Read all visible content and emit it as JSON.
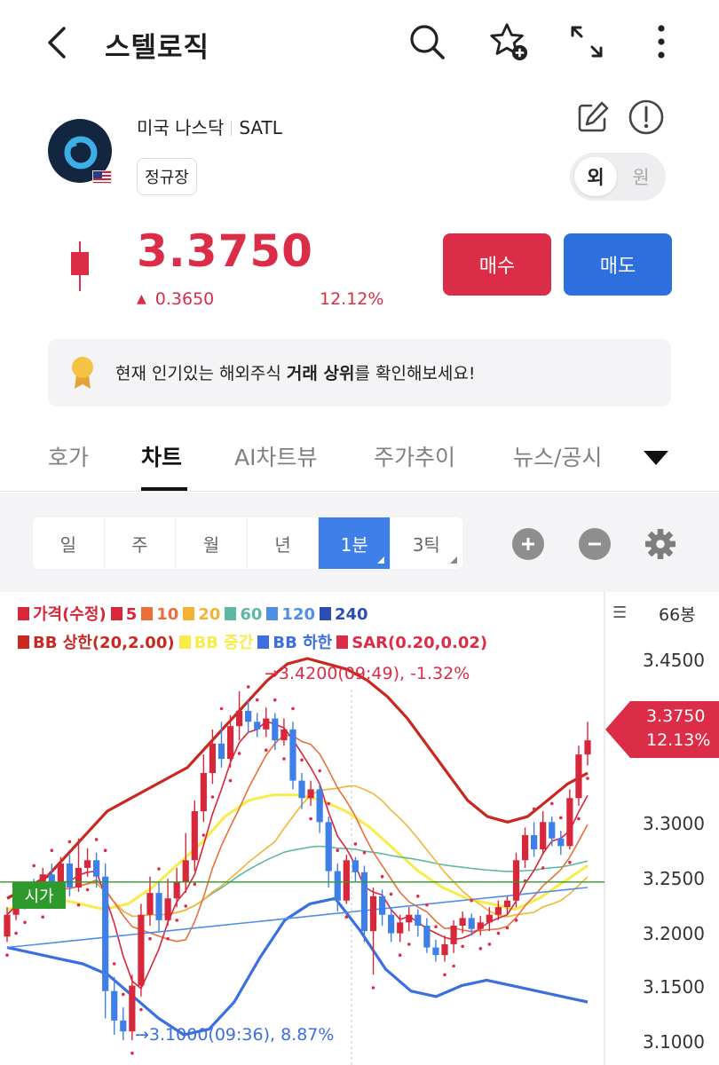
{
  "header": {
    "title": "스텔로직"
  },
  "stock": {
    "market": "미국 나스닥",
    "ticker": "SATL",
    "session": "정규장",
    "currency_on": "외",
    "currency_off": "원",
    "price": "3.3750",
    "change": "0.3650",
    "change_pct": "12.12%"
  },
  "actions": {
    "buy": "매수",
    "sell": "매도"
  },
  "banner": {
    "pre": "현재 인기있는 해외주식 ",
    "bold": "거래 상위",
    "post": "를 확인해보세요!"
  },
  "tabs": [
    "호가",
    "차트",
    "AI차트뷰",
    "주가추이",
    "뉴스/공시"
  ],
  "periods": [
    "일",
    "주",
    "월",
    "년",
    "1분",
    "3틱"
  ],
  "legend": {
    "row1": [
      {
        "label": "가격(수정)",
        "color": "#d8263b"
      },
      {
        "label": "5",
        "color": "#d8263b"
      },
      {
        "label": "10",
        "color": "#e8703a"
      },
      {
        "label": "20",
        "color": "#f3b436"
      },
      {
        "label": "60",
        "color": "#5fb8a4"
      },
      {
        "label": "120",
        "color": "#4f8fe4"
      },
      {
        "label": "240",
        "color": "#2a4fb0"
      }
    ],
    "row2": [
      {
        "label": "BB 상한(20,2.00)",
        "color": "#c8281f"
      },
      {
        "label": "BB 중간",
        "color": "#f8ec4a"
      },
      {
        "label": "BB 하한",
        "color": "#3b6fe0"
      },
      {
        "label": "SAR(0.20,0.02)",
        "color": "#dc2d48"
      }
    ]
  },
  "axis": {
    "count": "66봉",
    "ticks": [
      "3.4500",
      "3.3000",
      "3.2500",
      "3.2000",
      "3.1500",
      "3.1000"
    ]
  },
  "chart_data": {
    "type": "candlestick",
    "interval": "1분",
    "y_range": [
      3.09,
      3.47
    ],
    "current": {
      "price": "3.3750",
      "pct": "12.13%"
    },
    "open_label": "시가",
    "open_price": 3.245,
    "high_annotation": "3.4200(09:49), -1.32%",
    "low_annotation": "3.1000(09:36), 8.87%",
    "candles": [
      [
        3.195,
        3.215,
        3.19,
        3.222
      ],
      [
        3.215,
        3.232,
        3.21,
        3.24
      ],
      [
        3.232,
        3.238,
        3.22,
        3.245
      ],
      [
        3.238,
        3.228,
        3.222,
        3.248
      ],
      [
        3.228,
        3.252,
        3.225,
        3.258
      ],
      [
        3.252,
        3.245,
        3.238,
        3.262
      ],
      [
        3.245,
        3.262,
        3.24,
        3.268
      ],
      [
        3.262,
        3.24,
        3.232,
        3.27
      ],
      [
        3.24,
        3.258,
        3.236,
        3.285
      ],
      [
        3.258,
        3.265,
        3.25,
        3.276
      ],
      [
        3.265,
        3.25,
        3.24,
        3.272
      ],
      [
        3.25,
        3.145,
        3.12,
        3.262
      ],
      [
        3.145,
        3.118,
        3.105,
        3.158
      ],
      [
        3.118,
        3.108,
        3.1,
        3.13
      ],
      [
        3.108,
        3.15,
        3.1,
        3.16
      ],
      [
        3.15,
        3.215,
        3.14,
        3.225
      ],
      [
        3.215,
        3.235,
        3.205,
        3.25
      ],
      [
        3.235,
        3.21,
        3.2,
        3.245
      ],
      [
        3.21,
        3.23,
        3.205,
        3.248
      ],
      [
        3.23,
        3.245,
        3.222,
        3.258
      ],
      [
        3.245,
        3.265,
        3.235,
        3.29
      ],
      [
        3.265,
        3.31,
        3.255,
        3.32
      ],
      [
        3.31,
        3.345,
        3.3,
        3.362
      ],
      [
        3.345,
        3.372,
        3.335,
        3.385
      ],
      [
        3.372,
        3.358,
        3.35,
        3.392
      ],
      [
        3.358,
        3.388,
        3.35,
        3.398
      ],
      [
        3.388,
        3.402,
        3.375,
        3.42
      ],
      [
        3.402,
        3.392,
        3.382,
        3.412
      ],
      [
        3.392,
        3.385,
        3.378,
        3.4
      ],
      [
        3.385,
        3.395,
        3.378,
        3.405
      ],
      [
        3.395,
        3.375,
        3.366,
        3.4
      ],
      [
        3.375,
        3.385,
        3.37,
        3.395
      ],
      [
        3.385,
        3.338,
        3.33,
        3.392
      ],
      [
        3.338,
        3.322,
        3.312,
        3.345
      ],
      [
        3.322,
        3.33,
        3.315,
        3.338
      ],
      [
        3.33,
        3.3,
        3.29,
        3.335
      ],
      [
        3.3,
        3.255,
        3.24,
        3.305
      ],
      [
        3.255,
        3.228,
        3.218,
        3.262
      ],
      [
        3.228,
        3.265,
        3.225,
        3.27
      ],
      [
        3.265,
        3.254,
        3.245,
        3.268
      ],
      [
        3.254,
        3.2,
        3.19,
        3.26
      ],
      [
        3.2,
        3.232,
        3.16,
        3.24
      ],
      [
        3.232,
        3.215,
        3.205,
        3.238
      ],
      [
        3.215,
        3.198,
        3.19,
        3.222
      ],
      [
        3.198,
        3.208,
        3.19,
        3.215
      ],
      [
        3.208,
        3.215,
        3.2,
        3.222
      ],
      [
        3.215,
        3.205,
        3.195,
        3.22
      ],
      [
        3.205,
        3.185,
        3.18,
        3.212
      ],
      [
        3.185,
        3.178,
        3.172,
        3.192
      ],
      [
        3.178,
        3.188,
        3.172,
        3.196
      ],
      [
        3.188,
        3.205,
        3.18,
        3.21
      ],
      [
        3.205,
        3.212,
        3.198,
        3.218
      ],
      [
        3.212,
        3.202,
        3.196,
        3.216
      ],
      [
        3.202,
        3.208,
        3.196,
        3.214
      ],
      [
        3.208,
        3.215,
        3.2,
        3.222
      ],
      [
        3.215,
        3.222,
        3.21,
        3.228
      ],
      [
        3.222,
        3.228,
        3.215,
        3.232
      ],
      [
        3.228,
        3.265,
        3.222,
        3.272
      ],
      [
        3.265,
        3.288,
        3.258,
        3.295
      ],
      [
        3.288,
        3.275,
        3.268,
        3.3
      ],
      [
        3.275,
        3.3,
        3.27,
        3.31
      ],
      [
        3.3,
        3.285,
        3.278,
        3.305
      ],
      [
        3.285,
        3.278,
        3.27,
        3.292
      ],
      [
        3.278,
        3.322,
        3.275,
        3.33
      ],
      [
        3.322,
        3.362,
        3.315,
        3.37
      ],
      [
        3.362,
        3.375,
        3.352,
        3.392
      ]
    ],
    "bb_upper": [
      3.23,
      3.24,
      3.25,
      3.27,
      3.29,
      3.31,
      3.32,
      3.33,
      3.34,
      3.35,
      3.37,
      3.39,
      3.41,
      3.43,
      3.445,
      3.45,
      3.445,
      3.44,
      3.43,
      3.415,
      3.395,
      3.37,
      3.345,
      3.32,
      3.305,
      3.3,
      3.305,
      3.32,
      3.335,
      3.345
    ],
    "bb_mid": [
      3.22,
      3.225,
      3.23,
      3.225,
      3.22,
      3.225,
      3.24,
      3.26,
      3.28,
      3.305,
      3.32,
      3.325,
      3.325,
      3.32,
      3.31,
      3.295,
      3.275,
      3.255,
      3.24,
      3.23,
      3.225,
      3.22,
      3.23,
      3.245,
      3.26
    ],
    "bb_lower": [
      3.185,
      3.18,
      3.175,
      3.17,
      3.16,
      3.14,
      3.12,
      3.105,
      3.11,
      3.135,
      3.175,
      3.21,
      3.225,
      3.23,
      3.2,
      3.165,
      3.145,
      3.14,
      3.15,
      3.155,
      3.15,
      3.145,
      3.14,
      3.135
    ]
  }
}
